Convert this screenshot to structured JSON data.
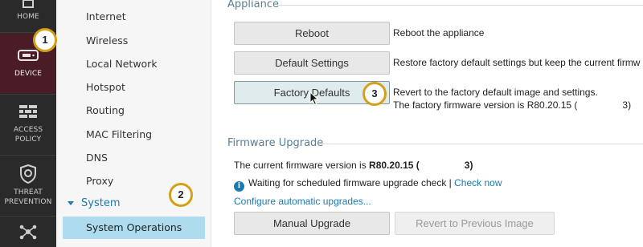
{
  "rail": {
    "home_label": "HOME",
    "device_label": "DEVICE",
    "access_label": "ACCESS\nPOLICY",
    "threat_label": "THREAT\nPREVENTION"
  },
  "subnav": {
    "items": [
      "Internet",
      "Wireless",
      "Local Network",
      "Hotspot",
      "Routing",
      "MAC Filtering",
      "DNS",
      "Proxy"
    ],
    "group": "System",
    "active": "System Operations"
  },
  "appliance": {
    "title": "Appliance",
    "reboot_label": "Reboot",
    "reboot_desc": "Reboot the appliance",
    "default_label": "Default Settings",
    "default_desc": "Restore factory default settings but keep the current firmw",
    "factory_label": "Factory Defaults",
    "factory_desc_1": "Revert to the factory default image and settings.",
    "factory_desc_2a": "The factory firmware version is R80.20.15 (",
    "factory_desc_2b": "3)"
  },
  "firmware": {
    "title": "Firmware Upgrade",
    "current_prefix": "The current firmware version is ",
    "current_version": "R80.20.15 (",
    "current_suffix": "3)",
    "waiting": "Waiting for scheduled firmware upgrade check | ",
    "check_now": "Check now",
    "configure": "Configure automatic upgrades...",
    "manual_label": "Manual Upgrade",
    "revert_label": "Revert to Previous Image"
  },
  "annotations": [
    "1",
    "2",
    "3"
  ],
  "colors": {
    "rail_bg": "#2a2a2a",
    "rail_active": "#4a1c25",
    "accent": "#1a7ab0",
    "nav_active_bg": "#aedcee",
    "badge_border": "#d4a017"
  }
}
